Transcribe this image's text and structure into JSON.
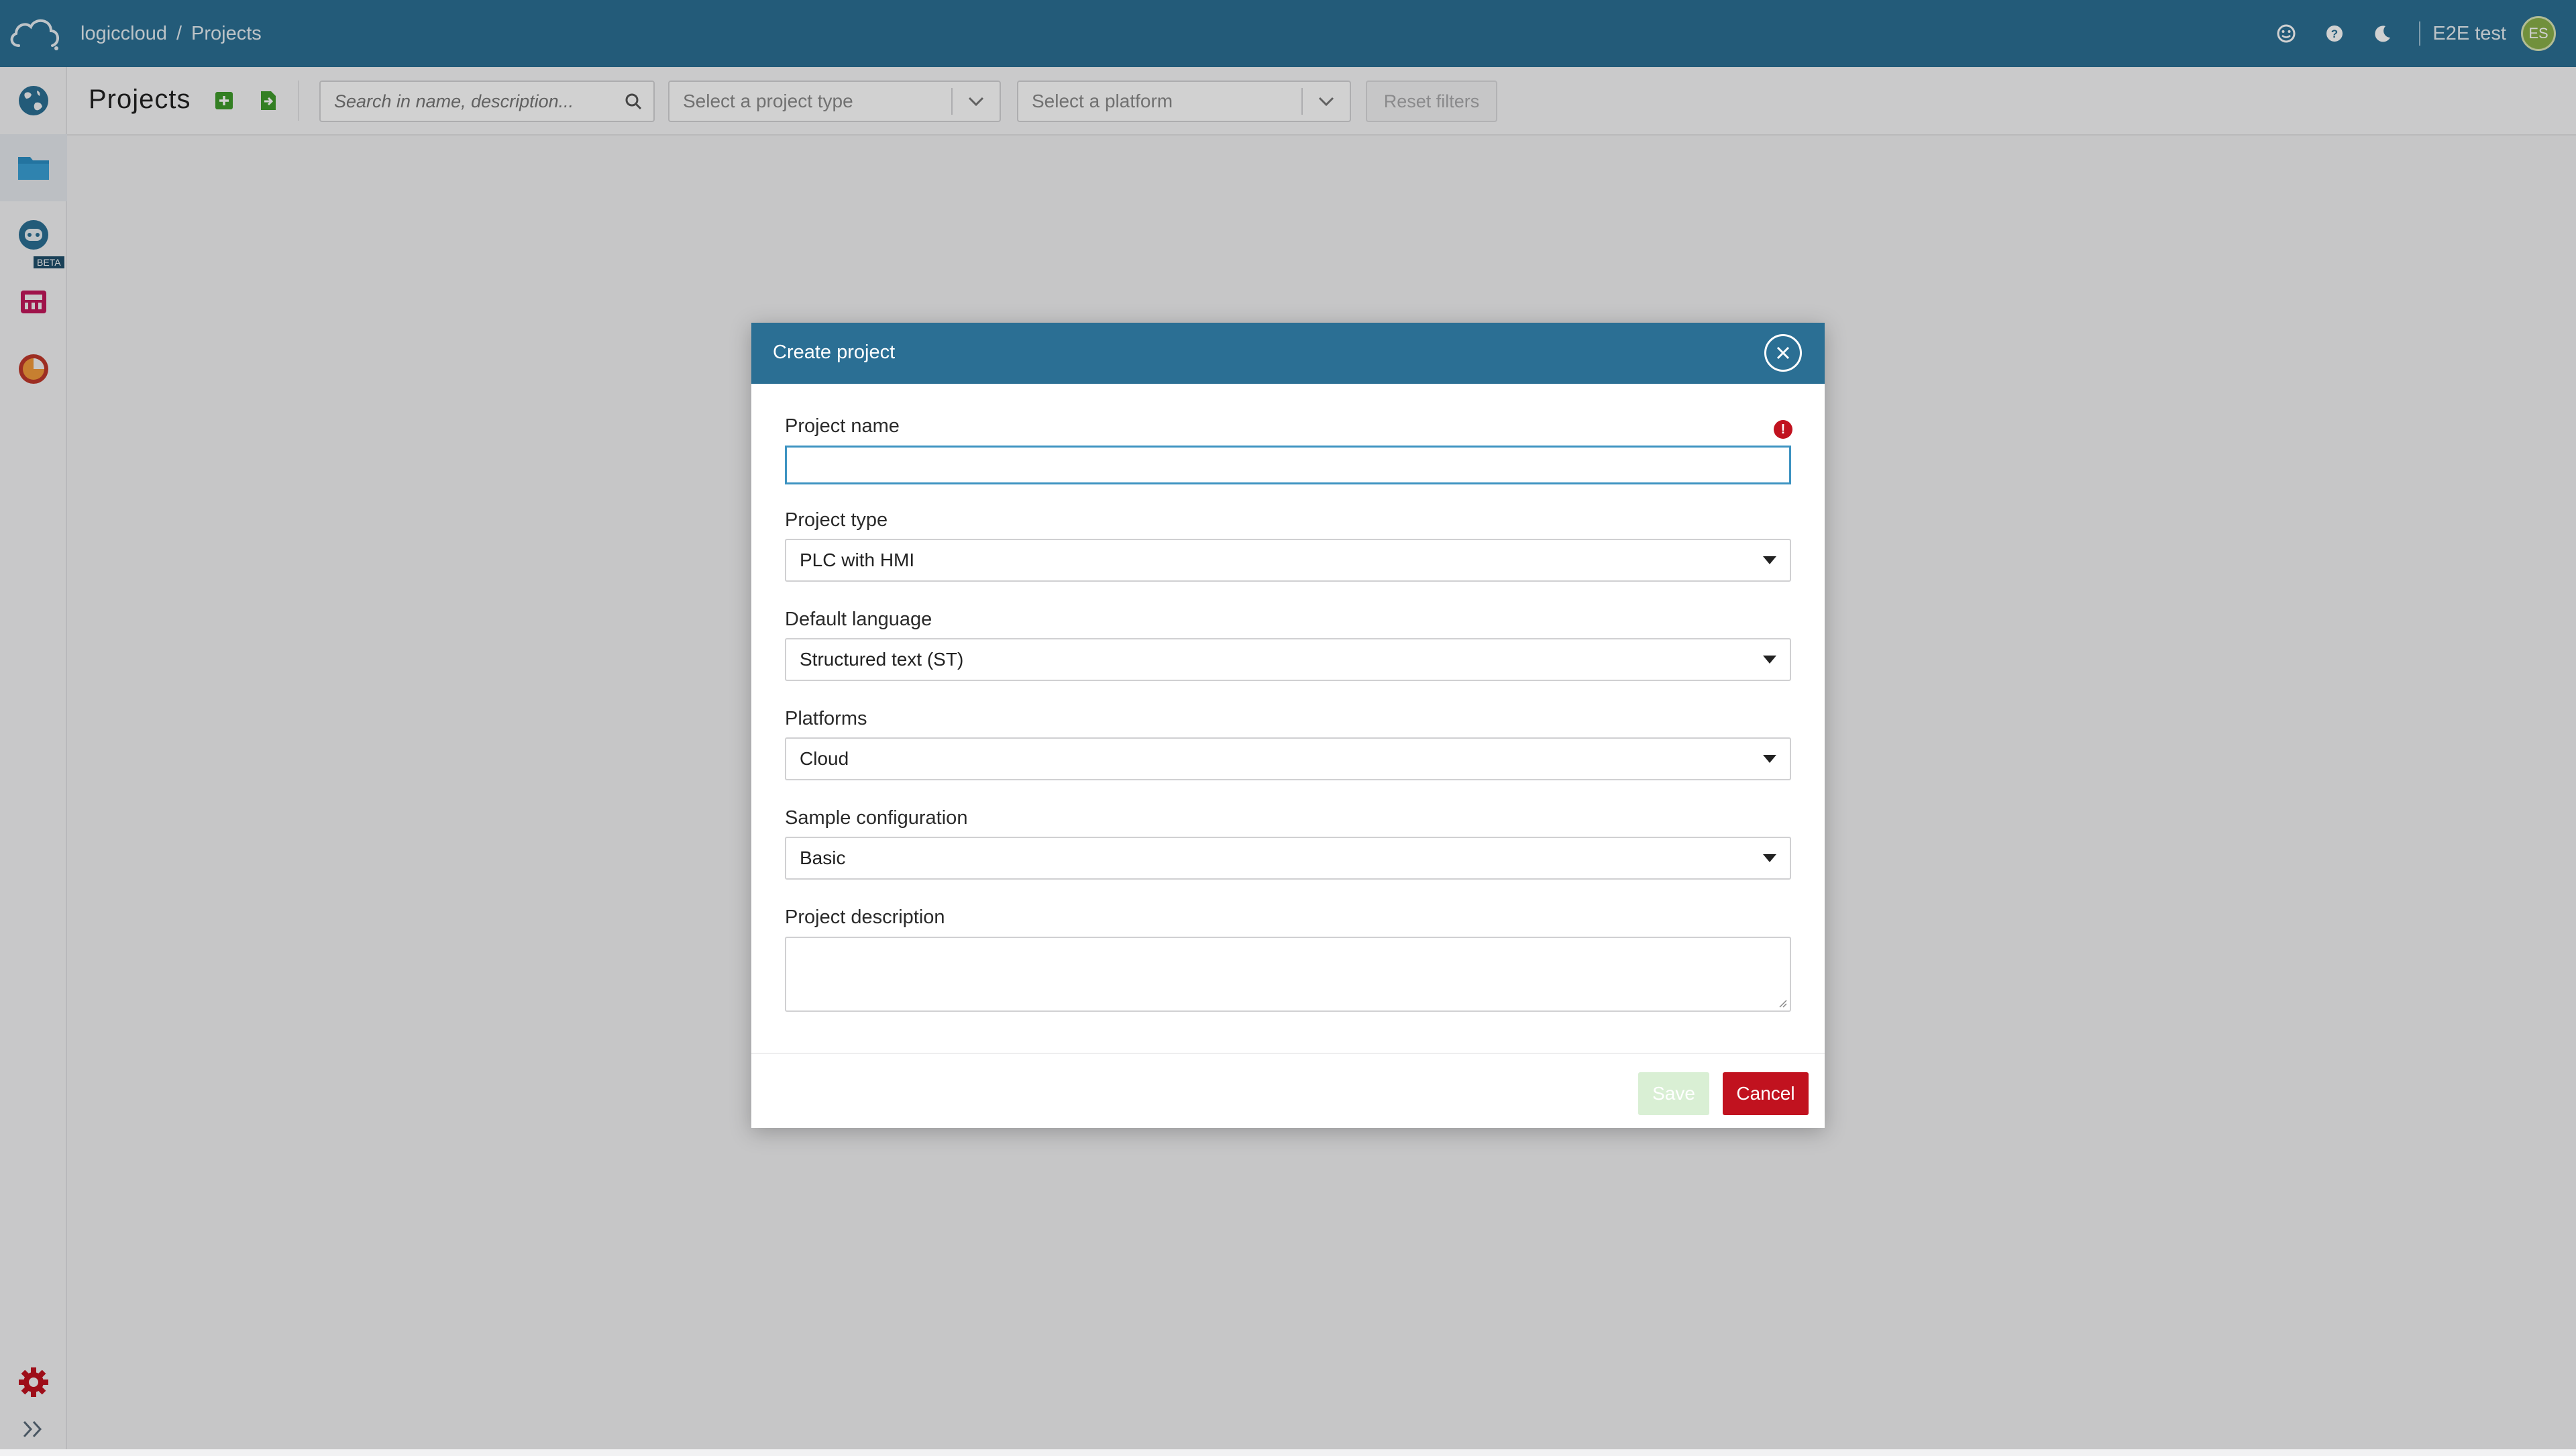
{
  "header": {
    "breadcrumb": [
      "logiccloud",
      "Projects"
    ],
    "breadcrumb_separator": "/",
    "username": "E2E test",
    "avatar_initials": "ES",
    "icons": [
      "logo-cloud-icon",
      "feedback-smiley-icon",
      "help-icon",
      "dark-mode-moon-icon"
    ]
  },
  "sidebar": {
    "items": [
      {
        "name": "globe-icon",
        "active": false
      },
      {
        "name": "projects-folder-icon",
        "active": true
      },
      {
        "name": "robot-assistant-icon",
        "active": false,
        "badge": "BETA"
      },
      {
        "name": "devices-icon",
        "active": false
      },
      {
        "name": "analytics-icon",
        "active": false
      }
    ],
    "bottom": [
      "settings-gear-icon",
      "expand-chevrons-icon"
    ]
  },
  "toolbar": {
    "title": "Projects",
    "search_placeholder": "Search in name, description...",
    "project_type_placeholder": "Select a project type",
    "platform_placeholder": "Select a platform",
    "reset_label": "Reset filters"
  },
  "modal": {
    "title": "Create project",
    "fields": {
      "project_name": {
        "label": "Project name",
        "value": "",
        "error": true
      },
      "project_type": {
        "label": "Project type",
        "value": "PLC with HMI"
      },
      "default_language": {
        "label": "Default language",
        "value": "Structured text (ST)"
      },
      "platforms": {
        "label": "Platforms",
        "value": "Cloud"
      },
      "sample_configuration": {
        "label": "Sample configuration",
        "value": "Basic"
      },
      "project_description": {
        "label": "Project description",
        "value": ""
      }
    },
    "save_label": "Save",
    "cancel_label": "Cancel"
  },
  "colors": {
    "brand": "#2b6f94",
    "danger": "#c1121f",
    "save_disabled": "#d9efd4",
    "add_green": "#3f9b2b"
  }
}
